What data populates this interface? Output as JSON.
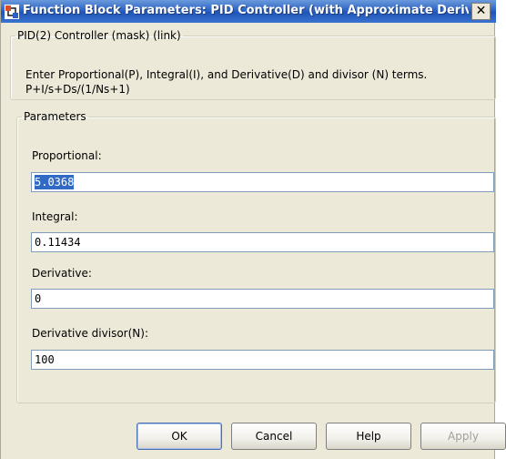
{
  "window": {
    "title": "Function Block Parameters: PID Controller (with Approximate Deriv...",
    "close_glyph": "✕",
    "app_icon": "simulink-block-icon"
  },
  "mask_group": {
    "legend": "PID(2) Controller (mask) (link)",
    "description_line1": "Enter Proportional(P), Integral(I), and Derivative(D) and divisor (N) terms.",
    "description_line2": "P+I/s+Ds/(1/Ns+1)"
  },
  "parameters_group": {
    "legend": "Parameters",
    "fields": [
      {
        "label": "Proportional:",
        "value": "5.0368",
        "selected": true
      },
      {
        "label": "Integral:",
        "value": "0.11434"
      },
      {
        "label": "Derivative:",
        "value": "0"
      },
      {
        "label": "Derivative divisor(N):",
        "value": "100"
      }
    ]
  },
  "buttons": {
    "ok": "OK",
    "cancel": "Cancel",
    "help": "Help",
    "apply": "Apply"
  },
  "colors": {
    "titlebar": "#2e63c4",
    "selection": "#316ac5",
    "dialog_bg": "#ece9d8"
  }
}
